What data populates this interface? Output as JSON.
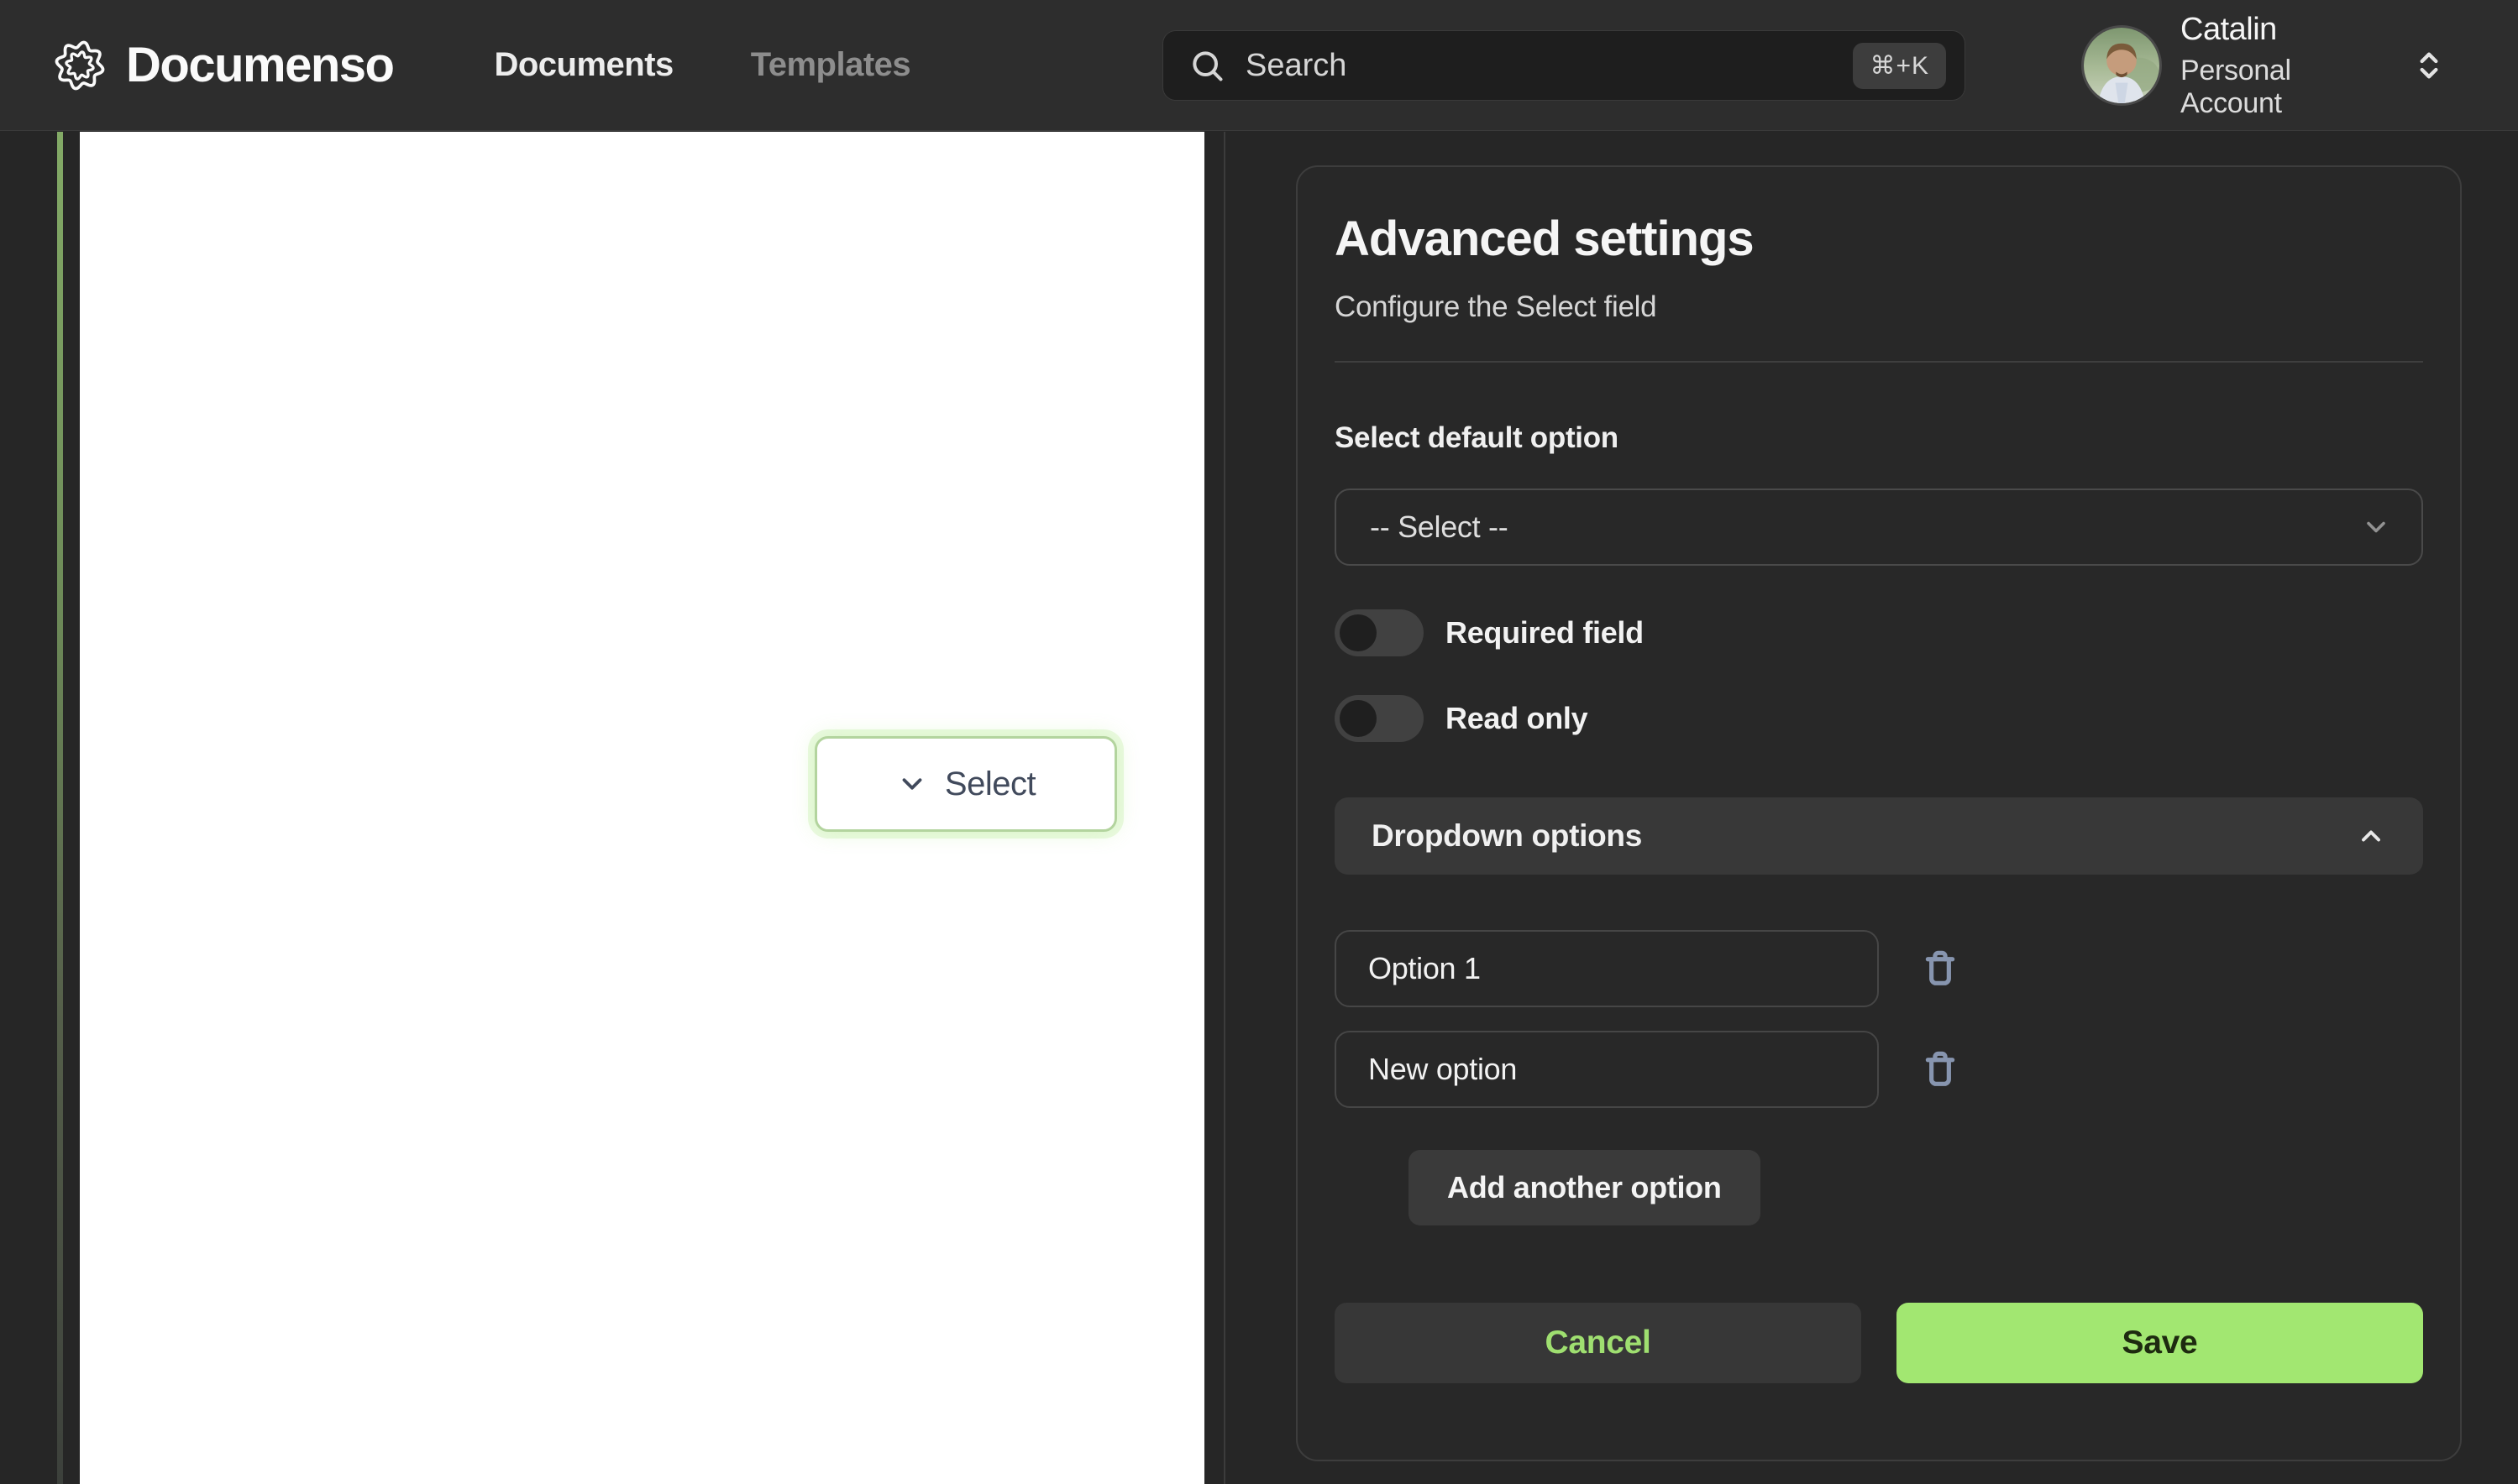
{
  "brand": {
    "name": "Documenso"
  },
  "nav": {
    "documents": "Documents",
    "templates": "Templates"
  },
  "search": {
    "placeholder": "Search",
    "shortcut": "⌘+K"
  },
  "account": {
    "name": "Catalin",
    "type": "Personal Account"
  },
  "document_page": {
    "field_label": "Select"
  },
  "panel": {
    "title": "Advanced settings",
    "subtitle": "Configure the Select field",
    "default_option": {
      "label": "Select default option",
      "value": "-- Select --"
    },
    "toggles": [
      {
        "label": "Required field",
        "state": "off"
      },
      {
        "label": "Read only",
        "state": "off"
      }
    ],
    "dropdown_options": {
      "header": "Dropdown options",
      "options": [
        "Option 1",
        "New option"
      ],
      "add_label": "Add another option"
    },
    "actions": {
      "cancel": "Cancel",
      "save": "Save"
    }
  },
  "colors": {
    "accent_green": "#a2e771",
    "field_border_green": "#b3d49e",
    "trash_icon": "#8795af",
    "navbar_bg": "#2d2d2d",
    "page_bg": "#262626",
    "card_bg": "#282828"
  }
}
